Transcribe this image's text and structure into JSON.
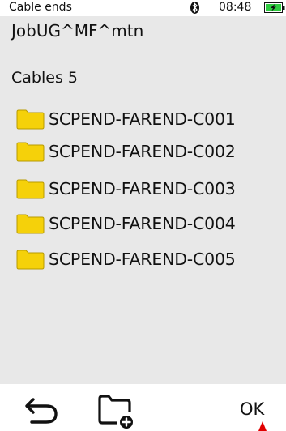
{
  "status_bar": {
    "title": "Cable ends",
    "time": "08:48",
    "bluetooth_icon": "bluetooth-icon",
    "battery_icon": "battery-charging-icon"
  },
  "job": {
    "name": "JobUG^MF^mtn"
  },
  "cables": {
    "count_label": "Cables 5"
  },
  "list": {
    "items": [
      {
        "label": "SCPEND-FAREND-C001",
        "icon": "folder-icon"
      },
      {
        "label": "SCPEND-FAREND-C002",
        "icon": "folder-icon"
      },
      {
        "label": "SCPEND-FAREND-C003",
        "icon": "folder-icon"
      },
      {
        "label": "SCPEND-FAREND-C004",
        "icon": "folder-icon"
      },
      {
        "label": "SCPEND-FAREND-C005",
        "icon": "folder-icon"
      }
    ]
  },
  "toolbar": {
    "back_icon": "back-arrow-icon",
    "new_folder_icon": "new-folder-icon",
    "ok_label": "OK"
  },
  "colors": {
    "background": "#e8e8e8",
    "bar_background": "#ffffff",
    "folder_fill": "#f5d10a",
    "folder_stroke": "#b89a00",
    "battery_green": "#2ecc40",
    "marker_red": "#e00000"
  }
}
